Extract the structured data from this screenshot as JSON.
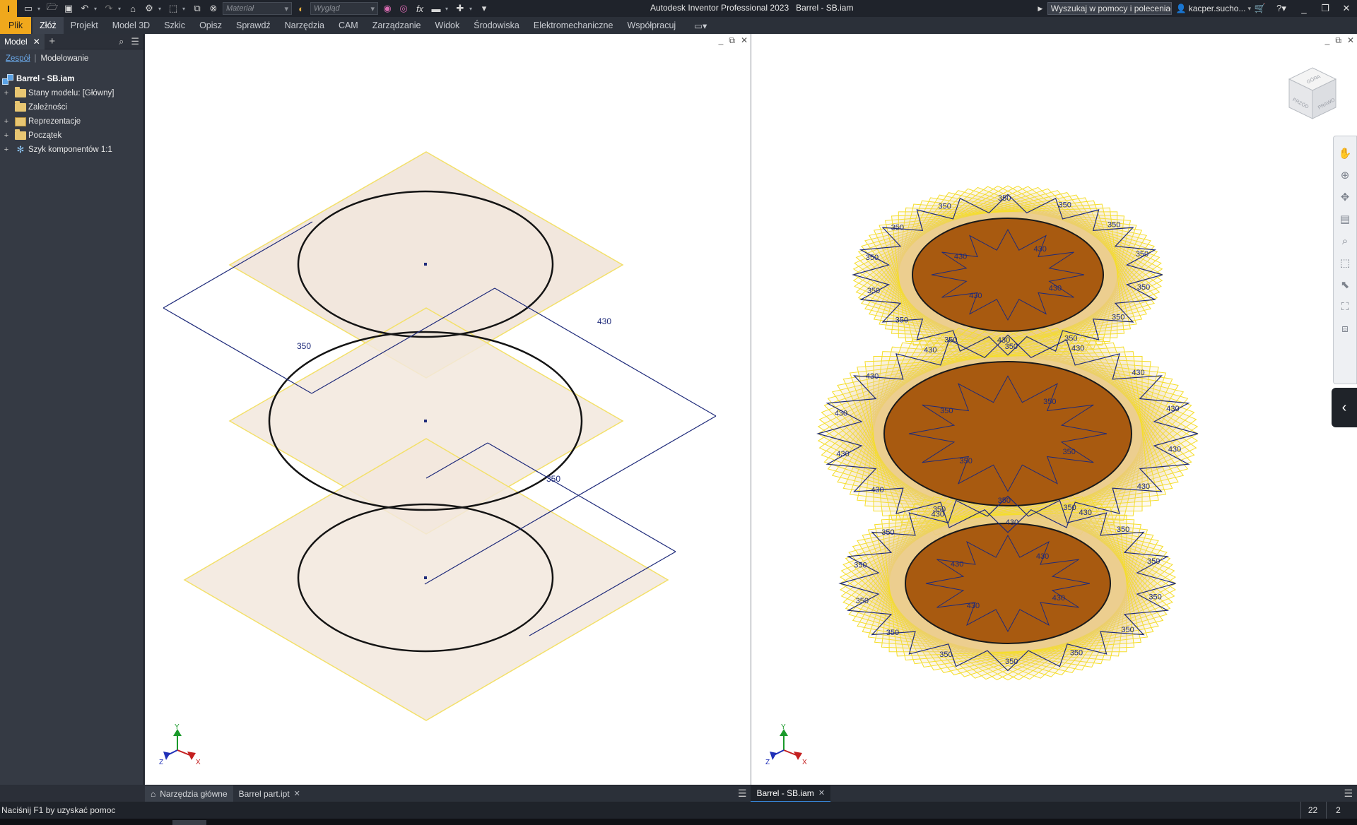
{
  "app": {
    "logo_letter": "I",
    "title": "Autodesk Inventor Professional 2023   Barrel - SB.iam",
    "material_placeholder": "Materiał",
    "appearance_placeholder": "Wygląd",
    "search_text": "Wyszukaj w pomocy i poleceniach",
    "user_name": "kacper.sucho...",
    "accent_color": "#f0a81c"
  },
  "ribbon": {
    "file_tab": "Plik",
    "tabs": [
      "Złóż",
      "Projekt",
      "Model 3D",
      "Szkic",
      "Opisz",
      "Sprawdź",
      "Narzędzia",
      "CAM",
      "Zarządzanie",
      "Widok",
      "Środowiska",
      "Elektromechaniczne",
      "Współpracuj"
    ]
  },
  "browser": {
    "tab_label": "Model",
    "sub_tab_assembly": "Zespół",
    "sub_tab_modeling": "Modelowanie",
    "tree": {
      "root": "Barrel - SB.iam",
      "items": [
        {
          "label": "Stany modelu: [Główny]",
          "expander": "+",
          "icon": "folder-icon"
        },
        {
          "label": "Zależności",
          "expander": "",
          "icon": "folder-icon"
        },
        {
          "label": "Reprezentacje",
          "expander": "+",
          "icon": "representations-icon"
        },
        {
          "label": "Początek",
          "expander": "+",
          "icon": "folder-icon"
        },
        {
          "label": "Szyk komponentów 1:1",
          "expander": "+",
          "icon": "component-pattern-icon"
        }
      ]
    }
  },
  "viewport_left": {
    "dimensions": [
      "350",
      "430",
      "350"
    ],
    "plane_color": "#f2e7dd",
    "plane_edge_color": "#f3e06a",
    "sketch_color": "#141414",
    "dimension_color": "#1e2a7a"
  },
  "viewport_right": {
    "view_cube_labels": [
      "GÓRA",
      "PRZÓD",
      "PRAWO"
    ],
    "dimension_values_outer": "350",
    "dimension_values_inner": "430",
    "body_color": "#a85a10"
  },
  "triad": {
    "x": "X",
    "y": "Y",
    "z": "Z"
  },
  "doc_tabs": {
    "home": "Narzędzia główne",
    "left_doc": "Barrel part.ipt",
    "right_doc": "Barrel - SB.iam"
  },
  "status": {
    "message": "Naciśnij F1 by uzyskać pomoc",
    "count_a": "22",
    "count_b": "2"
  }
}
